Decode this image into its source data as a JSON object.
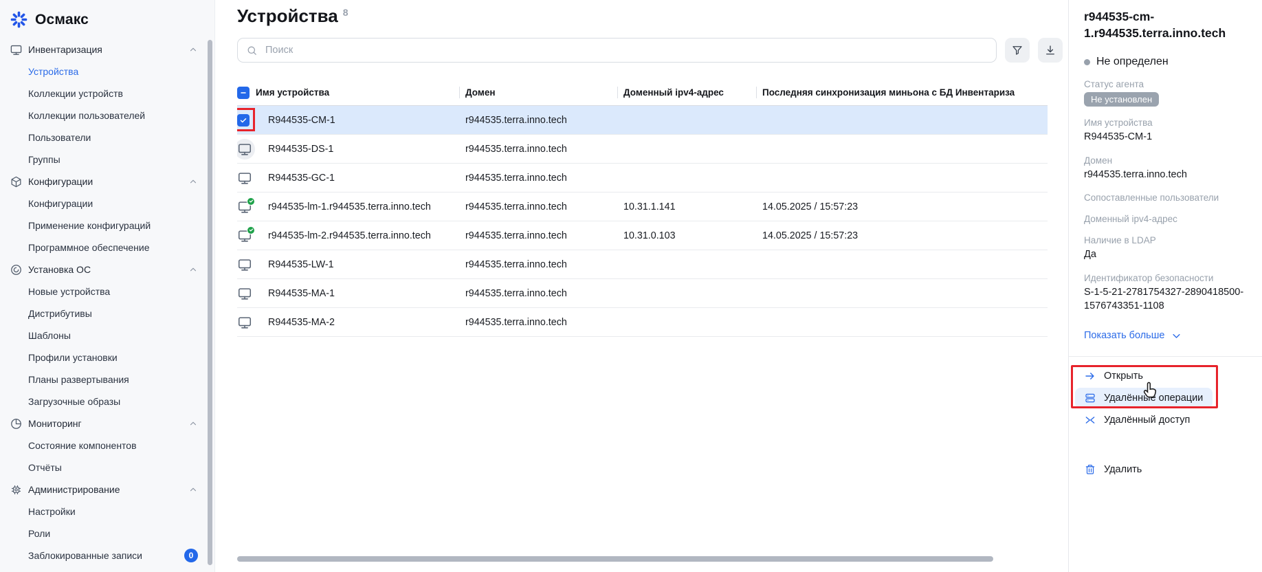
{
  "app": {
    "name": "Осмакс"
  },
  "sidebar": {
    "sections": [
      {
        "label": "Инвентаризация",
        "icon": "monitor-icon",
        "items": [
          {
            "label": "Устройства",
            "active": true
          },
          {
            "label": "Коллекции устройств"
          },
          {
            "label": "Коллекции пользователей"
          },
          {
            "label": "Пользователи"
          },
          {
            "label": "Группы"
          }
        ]
      },
      {
        "label": "Конфигурации",
        "icon": "package-icon",
        "items": [
          {
            "label": "Конфигурации"
          },
          {
            "label": "Применение конфигураций"
          },
          {
            "label": "Программное обеспечение"
          }
        ]
      },
      {
        "label": "Установка ОС",
        "icon": "os-disc-icon",
        "items": [
          {
            "label": "Новые устройства"
          },
          {
            "label": "Дистрибутивы"
          },
          {
            "label": "Шаблоны"
          },
          {
            "label": "Профили установки"
          },
          {
            "label": "Планы развертывания"
          },
          {
            "label": "Загрузочные образы"
          }
        ]
      },
      {
        "label": "Мониторинг",
        "icon": "pie-chart-icon",
        "items": [
          {
            "label": "Состояние компонентов"
          },
          {
            "label": "Отчёты"
          }
        ]
      },
      {
        "label": "Администрирование",
        "icon": "chip-icon",
        "items": [
          {
            "label": "Настройки"
          },
          {
            "label": "Роли"
          },
          {
            "label": "Заблокированные записи",
            "badge": "0"
          }
        ]
      }
    ]
  },
  "header": {
    "title": "Устройства",
    "count": "8"
  },
  "search": {
    "placeholder": "Поиск"
  },
  "table": {
    "columns": [
      "Имя устройства",
      "Домен",
      "Доменный ipv4-адрес",
      "Последняя синхронизация миньона с БД Инвентариза"
    ],
    "rows": [
      {
        "name": "R944535-CM-1",
        "domain": "r944535.terra.inno.tech",
        "ip": "",
        "sync": "",
        "selected": true
      },
      {
        "name": "R944535-DS-1",
        "domain": "r944535.terra.inno.tech",
        "ip": "",
        "sync": ""
      },
      {
        "name": "R944535-GC-1",
        "domain": "r944535.terra.inno.tech",
        "ip": "",
        "sync": ""
      },
      {
        "name": "r944535-lm-1.r944535.terra.inno.tech",
        "domain": "r944535.terra.inno.tech",
        "ip": "10.31.1.141",
        "sync": "14.05.2025 / 15:57:23"
      },
      {
        "name": "r944535-lm-2.r944535.terra.inno.tech",
        "domain": "r944535.terra.inno.tech",
        "ip": "10.31.0.103",
        "sync": "14.05.2025 / 15:57:23"
      },
      {
        "name": "R944535-LW-1",
        "domain": "r944535.terra.inno.tech",
        "ip": "",
        "sync": ""
      },
      {
        "name": "R944535-MA-1",
        "domain": "r944535.terra.inno.tech",
        "ip": "",
        "sync": ""
      },
      {
        "name": "R944535-MA-2",
        "domain": "r944535.terra.inno.tech",
        "ip": "",
        "sync": ""
      }
    ]
  },
  "details": {
    "title": "r944535-cm-1.r944535.terra.inno.tech",
    "status": "Не определен",
    "agent_status_label": "Статус агента",
    "agent_status_value": "Не установлен",
    "device_name_label": "Имя устройства",
    "device_name_value": "R944535-CM-1",
    "domain_label": "Домен",
    "domain_value": "r944535.terra.inno.tech",
    "matched_users_label": "Сопоставленные пользователи",
    "ip_label": "Доменный ipv4-адрес",
    "ldap_label": "Наличие в LDAP",
    "ldap_value": "Да",
    "sid_label": "Идентификатор безопасности",
    "sid_value": "S-1-5-21-2781754327-2890418500-1576743351-1108",
    "show_more": "Показать больше",
    "actions": {
      "open": "Открыть",
      "remote_operations": "Удалённые операции",
      "remote_access": "Удалённый доступ",
      "delete": "Удалить"
    }
  },
  "colors": {
    "accent_blue": "#2368e9",
    "active_link_blue": "#2b6be8",
    "selected_row_bg": "#dbe9fc",
    "annotation_red": "#e7232b",
    "badge_gray": "#9aa3ae",
    "synced_green": "#1fa24a"
  }
}
